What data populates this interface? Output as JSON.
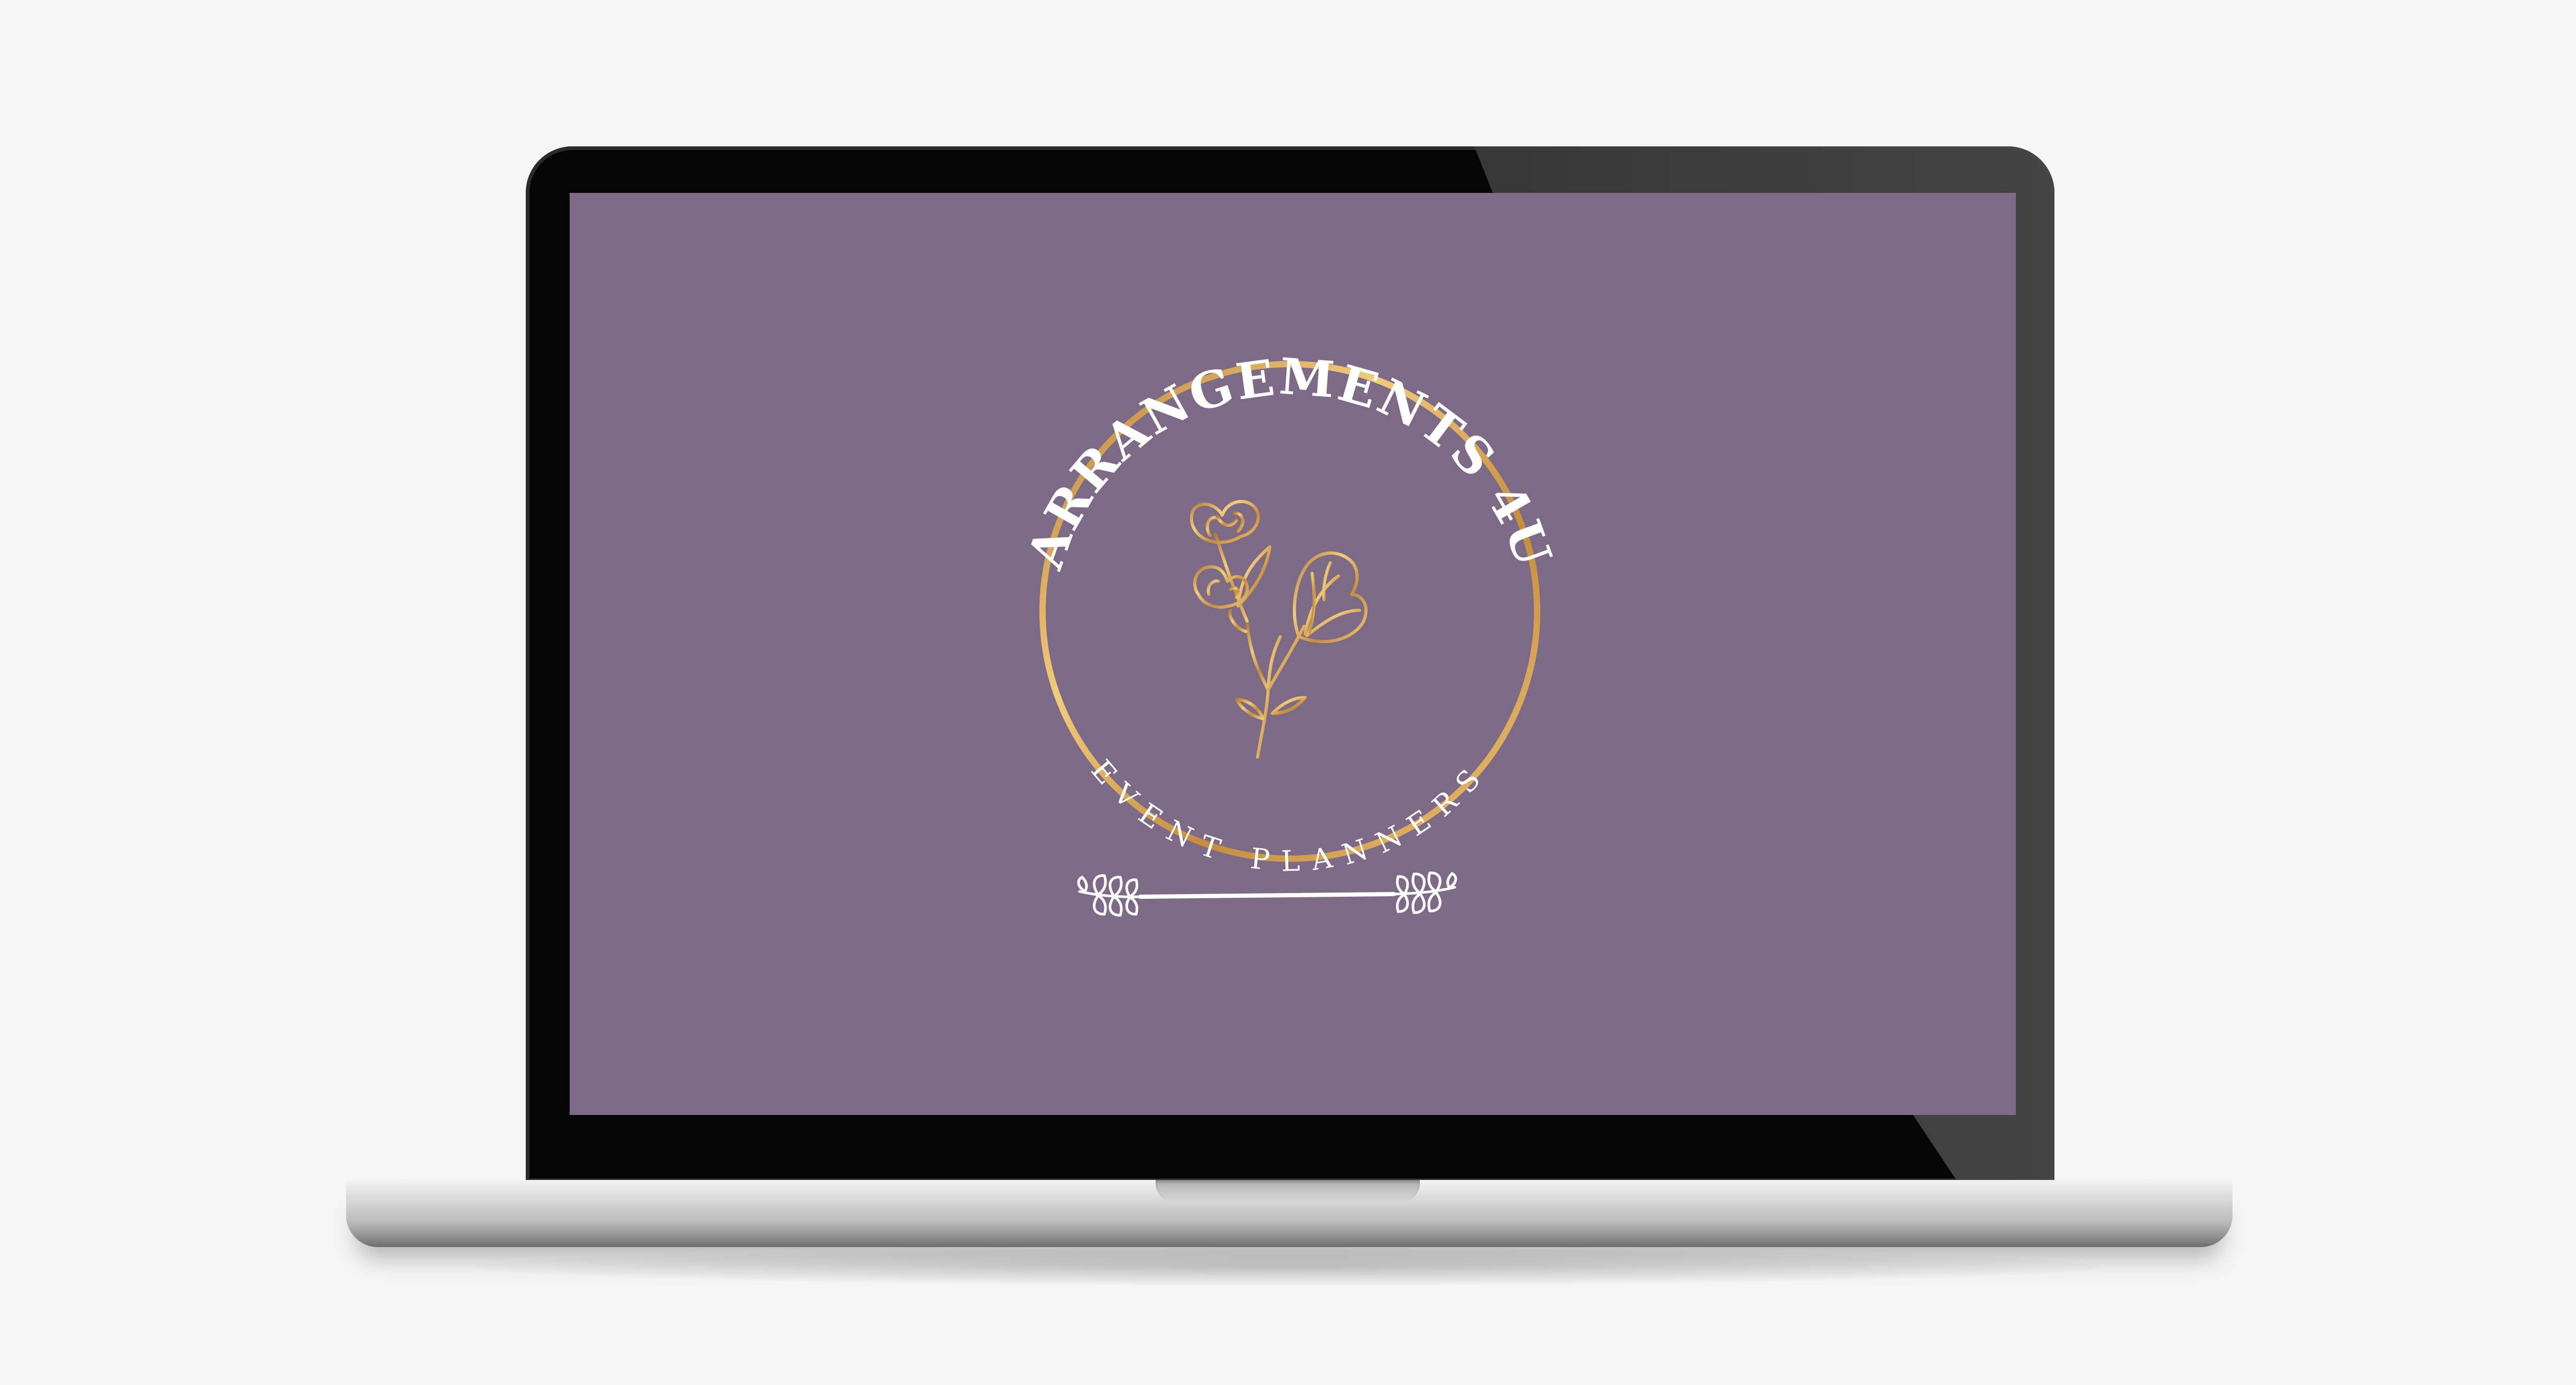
{
  "logo": {
    "brand_name": "ARRANGEMENTS 4U",
    "tagline": "EVENT PLANNERS"
  },
  "icons": {
    "emblem": "rose-flower-icon",
    "divider": "laurel-divider-icon"
  },
  "colors": {
    "page_background": "#f5f5f5",
    "screen_background": "#7d6a86",
    "gold_accent": "#d1a050",
    "bezel": "#050505",
    "text_white": "#ffffff"
  }
}
